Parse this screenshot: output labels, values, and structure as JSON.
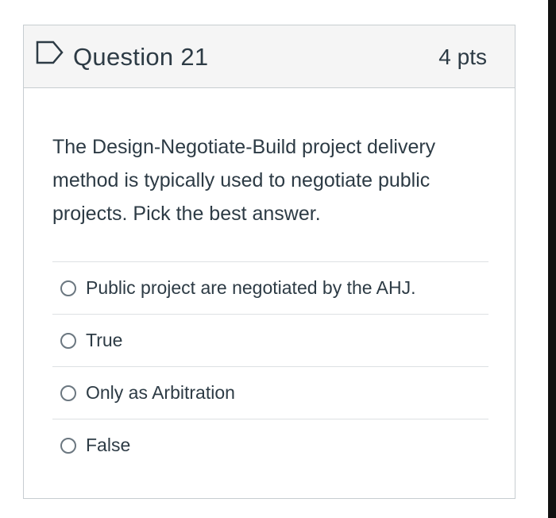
{
  "question": {
    "title": "Question 21",
    "points": "4 pts",
    "text": "The Design-Negotiate-Build project delivery method is typically used to negotiate public projects.  Pick the best answer.",
    "flag_icon": "flag-question-icon"
  },
  "answers": [
    {
      "label": "Public project are negotiated by the AHJ.",
      "selected": false
    },
    {
      "label": "True",
      "selected": false
    },
    {
      "label": "Only as Arbitration",
      "selected": false
    },
    {
      "label": "False",
      "selected": false
    }
  ],
  "colors": {
    "text": "#2d3b45",
    "header_bg": "#f5f5f5",
    "border": "#c7cdd1",
    "divider": "#dde1e3",
    "flag": "#2d3b45"
  }
}
